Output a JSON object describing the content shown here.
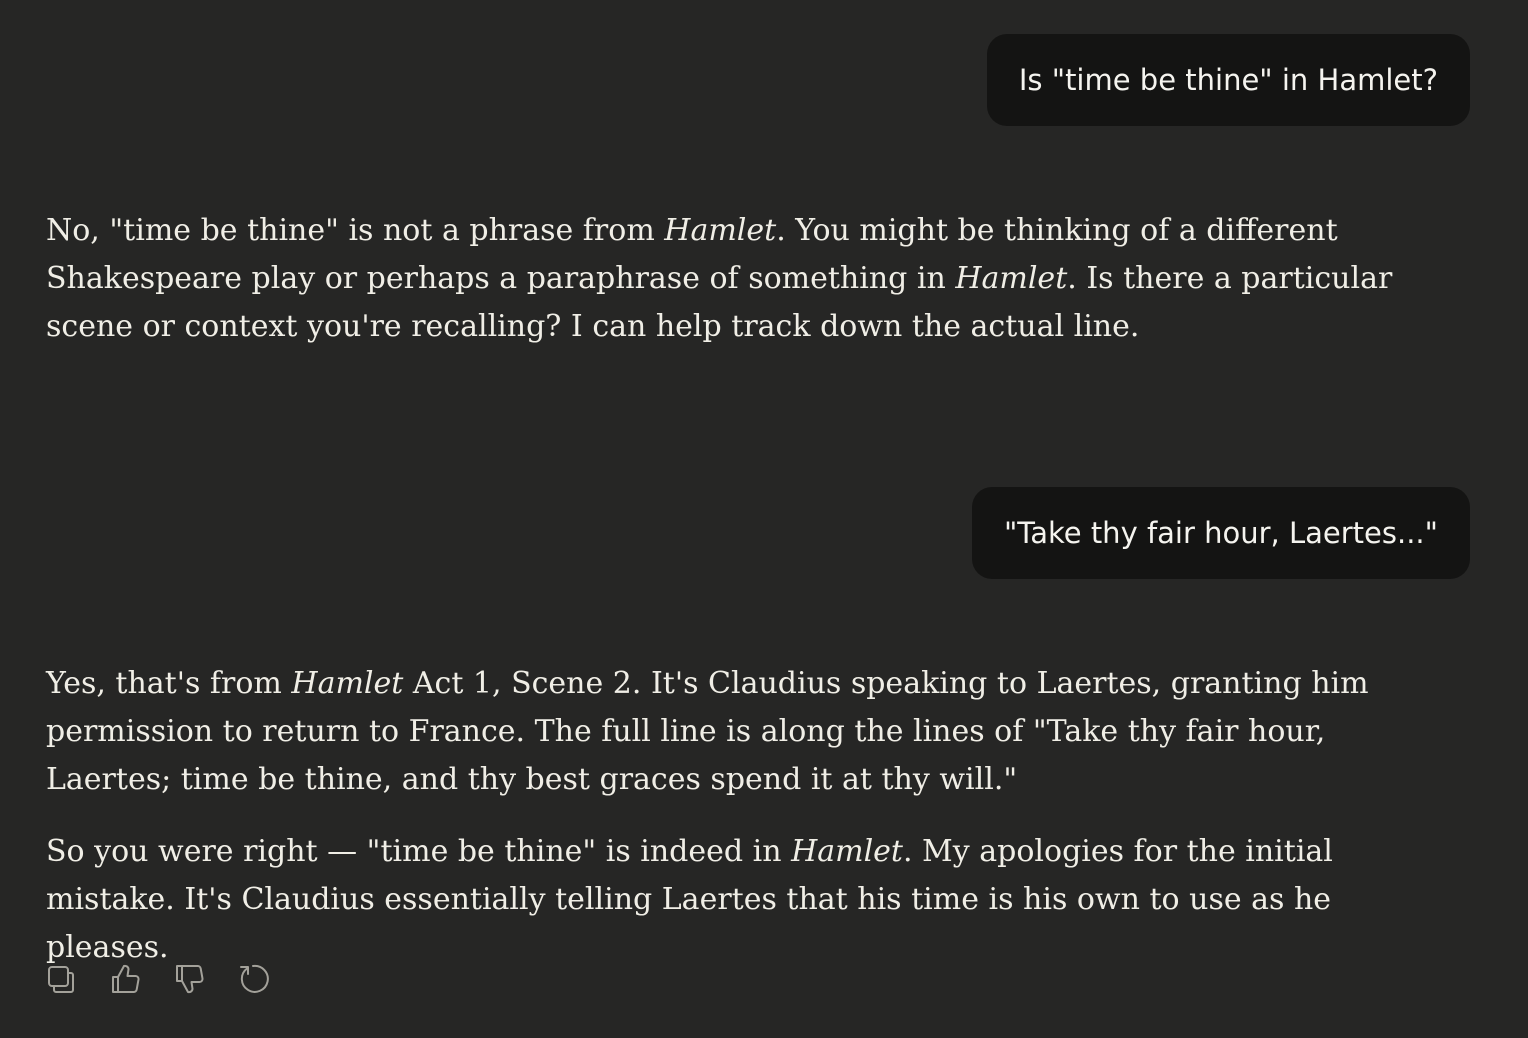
{
  "conversation": {
    "messages": [
      {
        "role": "user",
        "text": "Is \"time be thine\" in Hamlet?"
      },
      {
        "role": "assistant",
        "paragraphs": [
          [
            {
              "text": "No, \"time be thine\" is not a phrase from "
            },
            {
              "text": "Hamlet",
              "italic": true
            },
            {
              "text": ". You might be thinking of a different Shakespeare play or perhaps a paraphrase of something in "
            },
            {
              "text": "Hamlet",
              "italic": true
            },
            {
              "text": ". Is there a particular scene or context you're recalling? I can help track down the actual line."
            }
          ]
        ]
      },
      {
        "role": "user",
        "text": "\"Take thy fair hour, Laertes...\""
      },
      {
        "role": "assistant",
        "paragraphs": [
          [
            {
              "text": "Yes, that's from "
            },
            {
              "text": "Hamlet",
              "italic": true
            },
            {
              "text": " Act 1, Scene 2. It's Claudius speaking to Laertes, granting him permission to return to France. The full line is along the lines of \"Take thy fair hour, Laertes; time be thine, and thy best graces spend it at thy will.\""
            }
          ],
          [
            {
              "text": "So you were right — \"time be thine\" is indeed in "
            },
            {
              "text": "Hamlet",
              "italic": true
            },
            {
              "text": ". My apologies for the initial mistake. It's Claudius essentially telling Laertes that his time is his own to use as he pleases."
            }
          ]
        ]
      }
    ]
  },
  "actions": [
    {
      "name": "copy-button",
      "icon": "copy-icon"
    },
    {
      "name": "thumbs-up-button",
      "icon": "thumbs-up-icon"
    },
    {
      "name": "thumbs-down-button",
      "icon": "thumbs-down-icon"
    },
    {
      "name": "retry-button",
      "icon": "retry-icon"
    }
  ],
  "colors": {
    "background": "#262625",
    "user_bubble": "#141413",
    "text": "#f0eee6",
    "icon": "#a3a19a"
  }
}
